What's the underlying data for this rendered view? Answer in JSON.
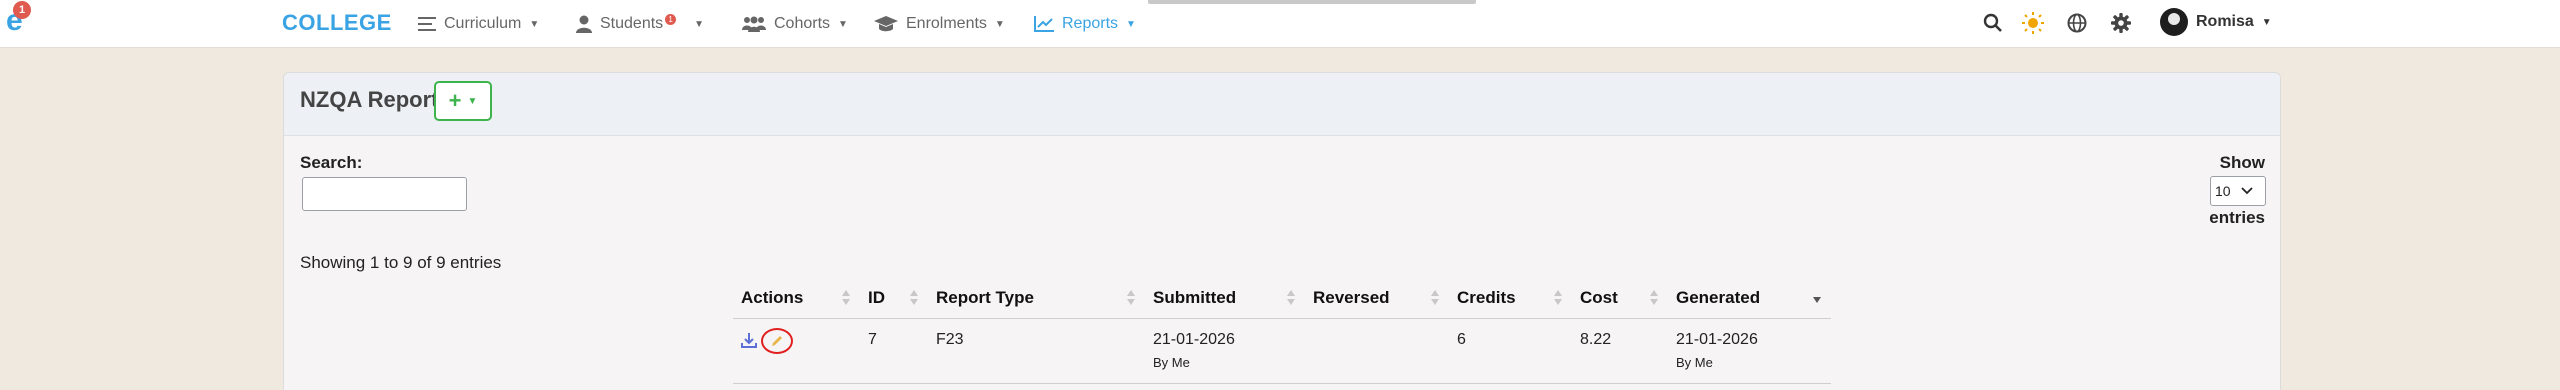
{
  "app": {
    "logo_badge": "1",
    "brand": "COLLEGE"
  },
  "nav": {
    "curriculum": "Curriculum",
    "students": "Students",
    "students_badge": "1",
    "cohorts": "Cohorts",
    "enrolments": "Enrolments",
    "reports": "Reports"
  },
  "user": {
    "name": "Romisa"
  },
  "icons": {
    "logo": "college-logo-icon",
    "search": "search-icon",
    "theme": "sun-icon",
    "language": "globe-icon",
    "settings": "gear-icon",
    "add": "plus-icon",
    "download": "download-icon",
    "edit": "pencil-icon"
  },
  "colors": {
    "accent": "#3aa3e3",
    "add_button": "#3cb44b",
    "badge": "#e05a4f",
    "highlight_ring": "#e02020"
  },
  "card": {
    "title": "NZQA Report",
    "add_label": "+"
  },
  "controls": {
    "search_label": "Search:",
    "search_value": "",
    "show_label": "Show",
    "entries_value": "10",
    "entries_label": "entries",
    "info": "Showing 1 to 9 of 9 entries"
  },
  "table": {
    "columns": [
      "Actions",
      "ID",
      "Report Type",
      "Submitted",
      "Reversed",
      "Credits",
      "Cost",
      "Generated"
    ],
    "rows": [
      {
        "id": "7",
        "report_type": "F23",
        "submitted": "21-01-2026",
        "submitted_by": "By Me",
        "reversed": "",
        "credits": "6",
        "cost": "8.22",
        "generated": "21-01-2026",
        "generated_by": "By Me"
      }
    ]
  }
}
